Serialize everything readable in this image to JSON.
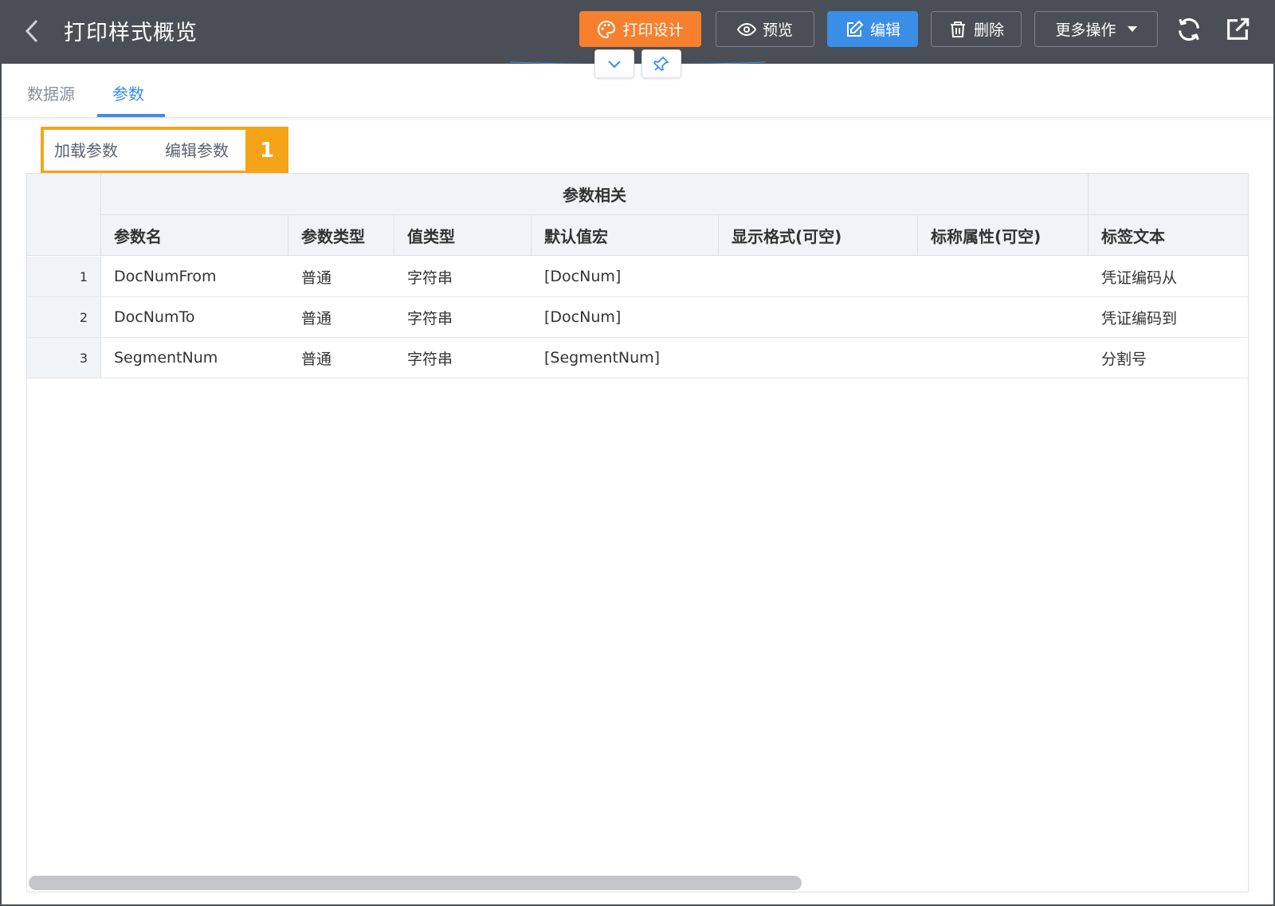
{
  "header": {
    "title": "打印样式概览",
    "buttons": {
      "print_design": "打印设计",
      "preview": "预览",
      "edit": "编辑",
      "delete": "删除",
      "more": "更多操作"
    }
  },
  "tabs": [
    {
      "label": "数据源"
    },
    {
      "label": "参数"
    }
  ],
  "actions": {
    "load_params": "加载参数",
    "edit_params": "编辑参数",
    "badge": "1"
  },
  "table": {
    "group_header": "参数相关",
    "columns": [
      "参数名",
      "参数类型",
      "值类型",
      "默认值宏",
      "显示格式(可空)",
      "标称属性(可空)",
      "标签文本"
    ],
    "rows": [
      {
        "num": "1",
        "name": "DocNumFrom",
        "ptype": "普通",
        "vtype": "字符串",
        "macro": "[DocNum]",
        "format": "",
        "attr": "",
        "label": "凭证编码从"
      },
      {
        "num": "2",
        "name": "DocNumTo",
        "ptype": "普通",
        "vtype": "字符串",
        "macro": "[DocNum]",
        "format": "",
        "attr": "",
        "label": "凭证编码到"
      },
      {
        "num": "3",
        "name": "SegmentNum",
        "ptype": "普通",
        "vtype": "字符串",
        "macro": "[SegmentNum]",
        "format": "",
        "attr": "",
        "label": "分割号"
      }
    ]
  },
  "colors": {
    "header_bg": "#4a4f57",
    "design_orange": "#f7802f",
    "primary_blue": "#3a8ee6",
    "highlight": "#f5a418"
  }
}
